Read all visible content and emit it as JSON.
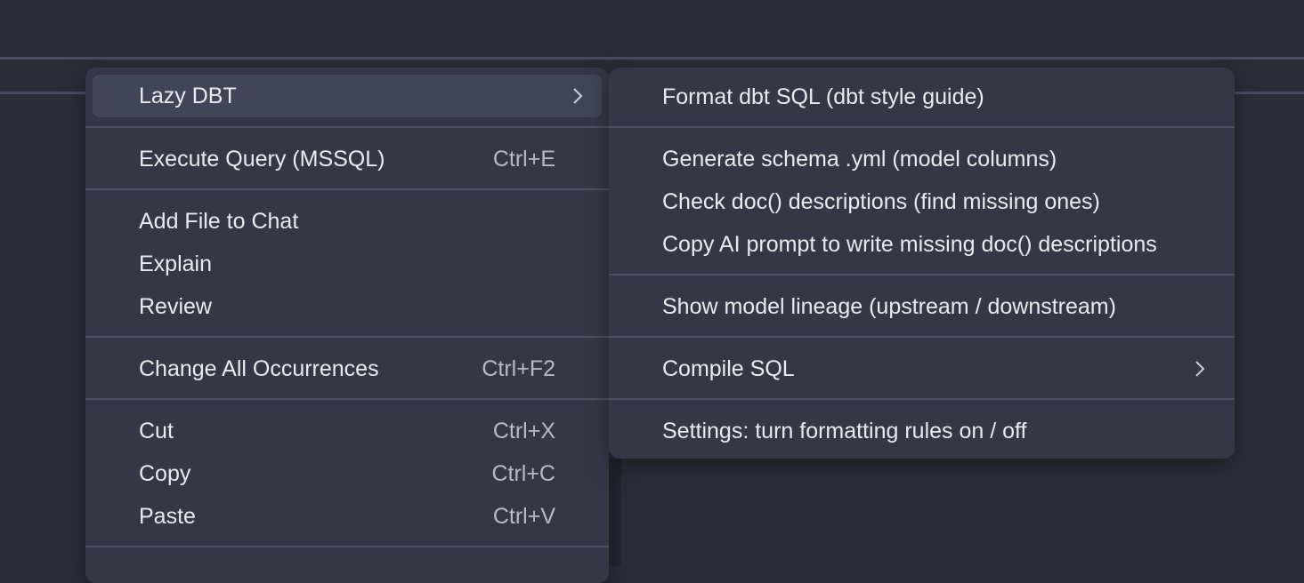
{
  "colors": {
    "background": "#2a2c38",
    "menu_bg": "#353747",
    "hover_bg": "#424557",
    "separator": "#4d5062",
    "text": "#e9eaf0",
    "shortcut_text": "#b8bac6"
  },
  "context_menu": {
    "items": [
      {
        "label": "Lazy DBT",
        "submenu_icon": "chevron-right-icon"
      },
      {
        "label": "Execute Query (MSSQL)",
        "shortcut": "Ctrl+E"
      },
      {
        "label": "Add File to Chat"
      },
      {
        "label": "Explain"
      },
      {
        "label": "Review"
      },
      {
        "label": "Change All Occurrences",
        "shortcut": "Ctrl+F2"
      },
      {
        "label": "Cut",
        "shortcut": "Ctrl+X"
      },
      {
        "label": "Copy",
        "shortcut": "Ctrl+C"
      },
      {
        "label": "Paste",
        "shortcut": "Ctrl+V"
      }
    ]
  },
  "submenu": {
    "items": [
      {
        "label": "Format dbt SQL (dbt style guide)"
      },
      {
        "label": "Generate schema .yml (model columns)"
      },
      {
        "label": "Check doc() descriptions (find missing ones)"
      },
      {
        "label": "Copy AI prompt to write missing doc() descriptions"
      },
      {
        "label": "Show model lineage (upstream / downstream)"
      },
      {
        "label": "Compile SQL",
        "submenu_icon": "chevron-right-icon"
      },
      {
        "label": "Settings: turn formatting rules on / off"
      }
    ]
  }
}
